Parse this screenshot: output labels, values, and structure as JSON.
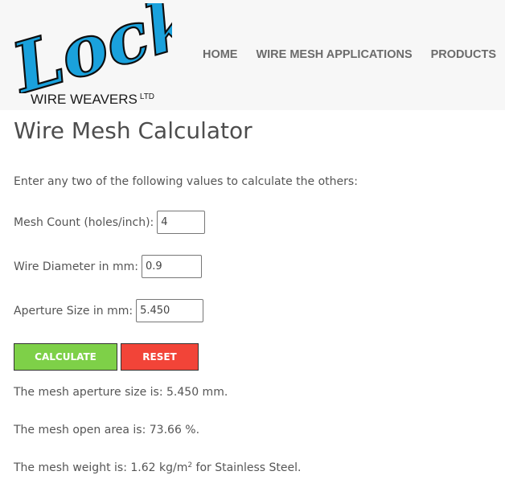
{
  "brand": {
    "logo_script": "Locker",
    "logo_sub": "WIRE WEAVERS",
    "logo_sup": "LTD",
    "accent": "#1aa1dc"
  },
  "nav": {
    "items": [
      "HOME",
      "WIRE MESH APPLICATIONS",
      "PRODUCTS"
    ]
  },
  "page": {
    "title": "Wire Mesh Calculator",
    "intro": "Enter any two of the following values to calculate the others:"
  },
  "form": {
    "mesh_count_label": "Mesh Count (holes/inch):",
    "mesh_count_value": "4",
    "wire_diameter_label": "Wire Diameter in mm:",
    "wire_diameter_value": "0.9",
    "aperture_label": "Aperture Size in mm:",
    "aperture_value": "5.450",
    "calculate_label": "CALCULATE",
    "reset_label": "RESET",
    "calculate_color": "#7ed048",
    "reset_color": "#f24438"
  },
  "results": {
    "aperture_prefix": "The mesh aperture size is: ",
    "aperture_value": "5.450",
    "aperture_suffix": " mm.",
    "open_area_prefix": "The mesh open area is: ",
    "open_area_value": "73.66",
    "open_area_suffix": " %.",
    "weight_prefix": "The mesh weight is: ",
    "weight_value": "1.62",
    "weight_unit": " kg/m",
    "weight_unit_sup": "2",
    "weight_suffix": " for Stainless Steel."
  }
}
